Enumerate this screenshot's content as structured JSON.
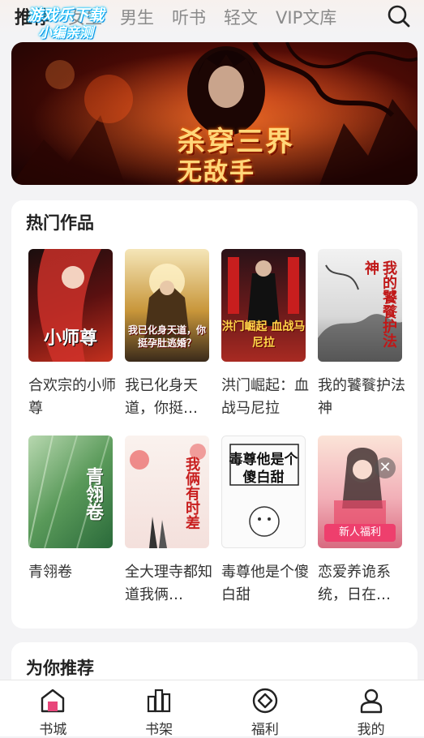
{
  "watermark": {
    "line1": "游戏乐下载",
    "line2": "小编亲测"
  },
  "tabs": [
    {
      "label": "推荐"
    },
    {
      "label": "女生"
    },
    {
      "label": "男生"
    },
    {
      "label": "听书"
    },
    {
      "label": "轻文"
    },
    {
      "label": "VIP文库"
    }
  ],
  "banner": {
    "title": "杀穿三界",
    "subtitle": "无敌手"
  },
  "hot": {
    "title": "热门作品",
    "books": [
      {
        "title": "合欢宗的小师尊",
        "cover_text": "小师尊"
      },
      {
        "title": "我已化身天道，你挺…",
        "cover_text": "我已化身天道，你挺孕肚逃婚？"
      },
      {
        "title": "洪门崛起：血战马尼拉",
        "cover_text": "洪门崛起 血战马尼拉"
      },
      {
        "title": "我的饕餮护法神",
        "cover_text": "我的饕餮护法神"
      },
      {
        "title": "青翎卷",
        "cover_text": "青翎卷"
      },
      {
        "title": "全大理寺都知道我俩…",
        "cover_text": "我俩有时差"
      },
      {
        "title": "毒尊他是个傻白甜",
        "cover_text": "毒尊他是个傻白甜"
      },
      {
        "title": "恋爱养诡系统，日在…",
        "cover_text": ""
      }
    ],
    "ribbon": "新人福利"
  },
  "recommend": {
    "title": "为你推荐"
  },
  "nav": [
    {
      "label": "书城",
      "icon": "store-icon"
    },
    {
      "label": "书架",
      "icon": "bookshelf-icon"
    },
    {
      "label": "福利",
      "icon": "welfare-icon"
    },
    {
      "label": "我的",
      "icon": "profile-icon"
    }
  ],
  "colors": {
    "accent": "#ee3f6d",
    "nav_active": "#e8467a"
  }
}
